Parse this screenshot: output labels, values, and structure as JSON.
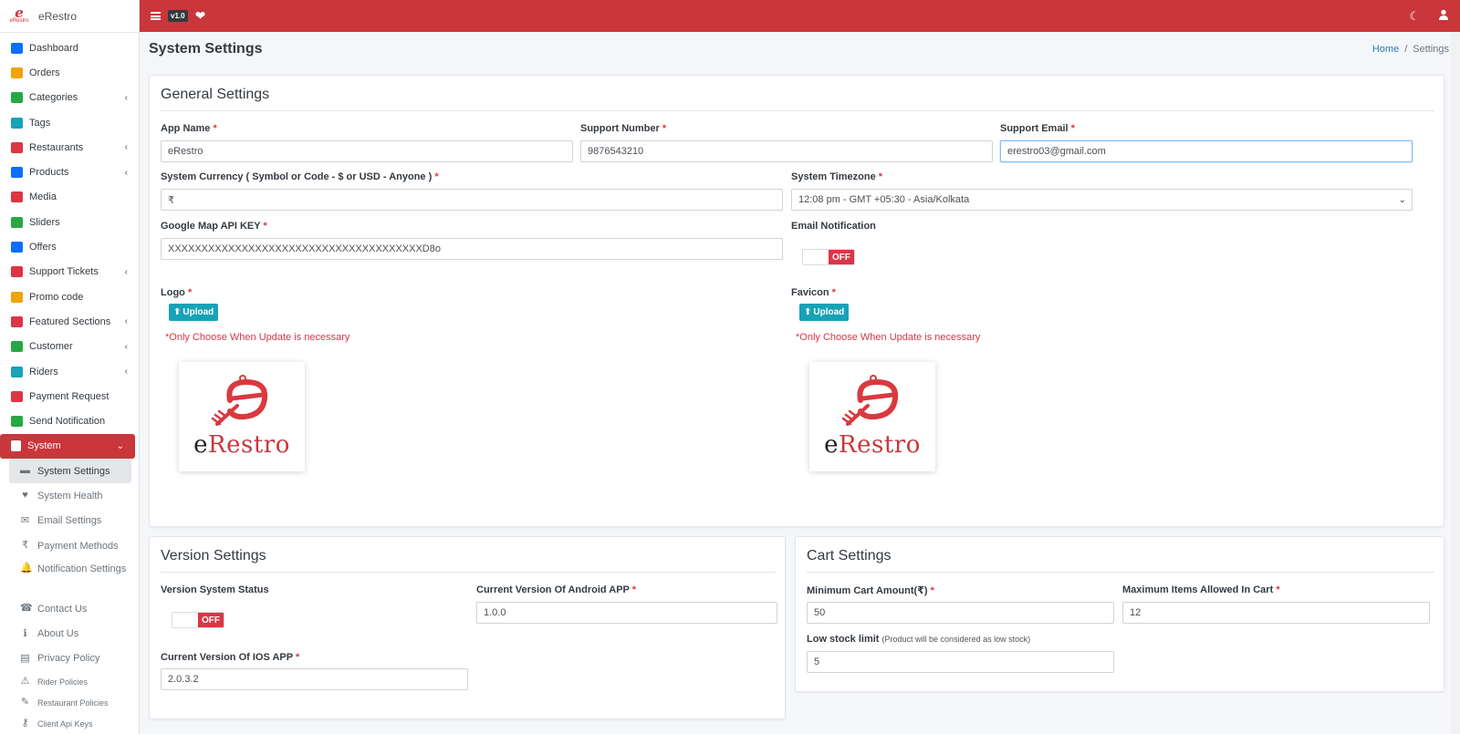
{
  "app": {
    "brand_name": "eRestro",
    "brand_logo_text": "eRestro",
    "version": "v1.0",
    "accent_color": "#c9363b"
  },
  "sidebar": {
    "items": [
      {
        "label": "Dashboard",
        "icon": "dashboard-icon",
        "color": "#0d6efd",
        "chevron": false
      },
      {
        "label": "Orders",
        "icon": "cart-icon",
        "color": "#f0a30a",
        "chevron": false
      },
      {
        "label": "Categories",
        "icon": "target-icon",
        "color": "#28a745",
        "chevron": true
      },
      {
        "label": "Tags",
        "icon": "tag-icon",
        "color": "#17a2b8",
        "chevron": false
      },
      {
        "label": "Restaurants",
        "icon": "store-icon",
        "color": "#dc3545",
        "chevron": true
      },
      {
        "label": "Products",
        "icon": "products-icon",
        "color": "#0d6efd",
        "chevron": true
      },
      {
        "label": "Media",
        "icon": "media-icon",
        "color": "#dc3545",
        "chevron": false
      },
      {
        "label": "Sliders",
        "icon": "sliders-icon",
        "color": "#28a745",
        "chevron": false
      },
      {
        "label": "Offers",
        "icon": "gift-icon",
        "color": "#0d6efd",
        "chevron": false
      },
      {
        "label": "Support Tickets",
        "icon": "ticket-icon",
        "color": "#dc3545",
        "chevron": true
      },
      {
        "label": "Promo code",
        "icon": "puzzle-icon",
        "color": "#f0a30a",
        "chevron": false
      },
      {
        "label": "Featured Sections",
        "icon": "layers-icon",
        "color": "#dc3545",
        "chevron": true
      },
      {
        "label": "Customer",
        "icon": "user-icon",
        "color": "#28a745",
        "chevron": true
      },
      {
        "label": "Riders",
        "icon": "id-badge-icon",
        "color": "#17a2b8",
        "chevron": true
      },
      {
        "label": "Payment Request",
        "icon": "money-icon",
        "color": "#dc3545",
        "chevron": false
      },
      {
        "label": "Send Notification",
        "icon": "paper-plane-icon",
        "color": "#28a745",
        "chevron": false
      }
    ],
    "system": {
      "label": "System",
      "icon": "wrench-icon",
      "sub_items": [
        {
          "label": "System Settings",
          "icon": "settings-icon",
          "glyph": "▬"
        },
        {
          "label": "System Health",
          "icon": "heartbeat-icon",
          "glyph": "♥"
        },
        {
          "label": "Email Settings",
          "icon": "email-icon",
          "glyph": "✉"
        },
        {
          "label": "Payment Methods",
          "icon": "rupee-icon",
          "glyph": "₹"
        },
        {
          "label": "Notification Settings",
          "icon": "bell-icon",
          "glyph": "🔔"
        },
        {
          "label": "Contact Us",
          "icon": "phone-icon",
          "glyph": "☎"
        },
        {
          "label": "About Us",
          "icon": "info-icon",
          "glyph": "ℹ"
        },
        {
          "label": "Privacy Policy",
          "icon": "privacy-icon",
          "glyph": "▤"
        },
        {
          "label": "Rider Policies",
          "icon": "warning-icon",
          "glyph": "⚠"
        },
        {
          "label": "Restaurant Policies",
          "icon": "edit-icon",
          "glyph": "✎"
        },
        {
          "label": "Client Api Keys",
          "icon": "key-icon",
          "glyph": "⚷"
        }
      ]
    }
  },
  "topbar": {
    "menu_icon": "hamburger-icon",
    "health_icon": "heartbeat-icon",
    "theme_icon": "moon-icon",
    "user_icon": "user-icon"
  },
  "page": {
    "title": "System Settings",
    "breadcrumb": {
      "home": "Home",
      "separator": "/",
      "current": "Settings"
    }
  },
  "general": {
    "title": "General Settings",
    "app_name": {
      "label": "App Name",
      "value": "eRestro"
    },
    "support_number": {
      "label": "Support Number",
      "value": "9876543210"
    },
    "support_email": {
      "label": "Support Email",
      "value": "erestro03@gmail.com"
    },
    "currency": {
      "label": "System Currency ( Symbol or Code - $ or USD - Anyone )",
      "value": "₹"
    },
    "timezone": {
      "label": "System Timezone",
      "value": "12:08 pm - GMT +05:30 - Asia/Kolkata"
    },
    "map_key": {
      "label": "Google Map API KEY",
      "value": "XXXXXXXXXXXXXXXXXXXXXXXXXXXXXXXXXXXXXXD8o"
    },
    "email_notification": {
      "label": "Email Notification",
      "state": "OFF"
    },
    "logo": {
      "label": "Logo",
      "button": "Upload",
      "warning": "*Only Choose When Update is necessary"
    },
    "favicon": {
      "label": "Favicon",
      "button": "Upload",
      "warning": "*Only Choose When Update is necessary"
    },
    "required_mark": "*"
  },
  "version": {
    "title": "Version Settings",
    "status": {
      "label": "Version System Status",
      "state": "OFF"
    },
    "android": {
      "label": "Current Version Of Android APP",
      "value": "1.0.0"
    },
    "ios": {
      "label": "Current Version Of IOS APP",
      "value": "2.0.3.2"
    }
  },
  "cart": {
    "title": "Cart Settings",
    "min_amount": {
      "label": "Minimum Cart Amount(₹)",
      "value": "50"
    },
    "max_items": {
      "label": "Maximum Items Allowed In Cart",
      "value": "12"
    },
    "low_stock": {
      "label": "Low stock limit",
      "hint": "(Product will be considered as low stock)",
      "value": "5"
    }
  }
}
